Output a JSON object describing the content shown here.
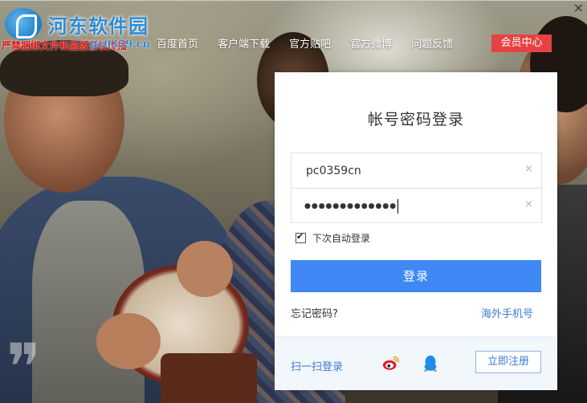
{
  "watermark": {
    "name": "河东软件园",
    "sub": "严禁捆绑文件和盗版侵权传播",
    "url": "pc0359.cn"
  },
  "nav": {
    "links": [
      "百度首页",
      "客户端下载",
      "官方贴吧",
      "官方微博",
      "问题反馈"
    ],
    "vip": "会员中心",
    "close": "×"
  },
  "login": {
    "title": "帐号密码登录",
    "username": "pc0359cn",
    "password_mask": "●●●●●●●●●●●●●",
    "clear": "×",
    "remember_label": "下次自动登录",
    "remember_checked": true,
    "submit": "登录",
    "forgot": "忘记密码?",
    "overseas": "海外手机号"
  },
  "footer": {
    "scan": "扫一扫登录",
    "weibo_icon": "weibo-icon",
    "qq_icon": "qq-icon",
    "register": "立即注册"
  },
  "colors": {
    "primary": "#3f88f5",
    "vip": "#e74243",
    "link": "#3b7ad8",
    "weibo": "#e6162d",
    "qq": "#1e8ee8"
  }
}
